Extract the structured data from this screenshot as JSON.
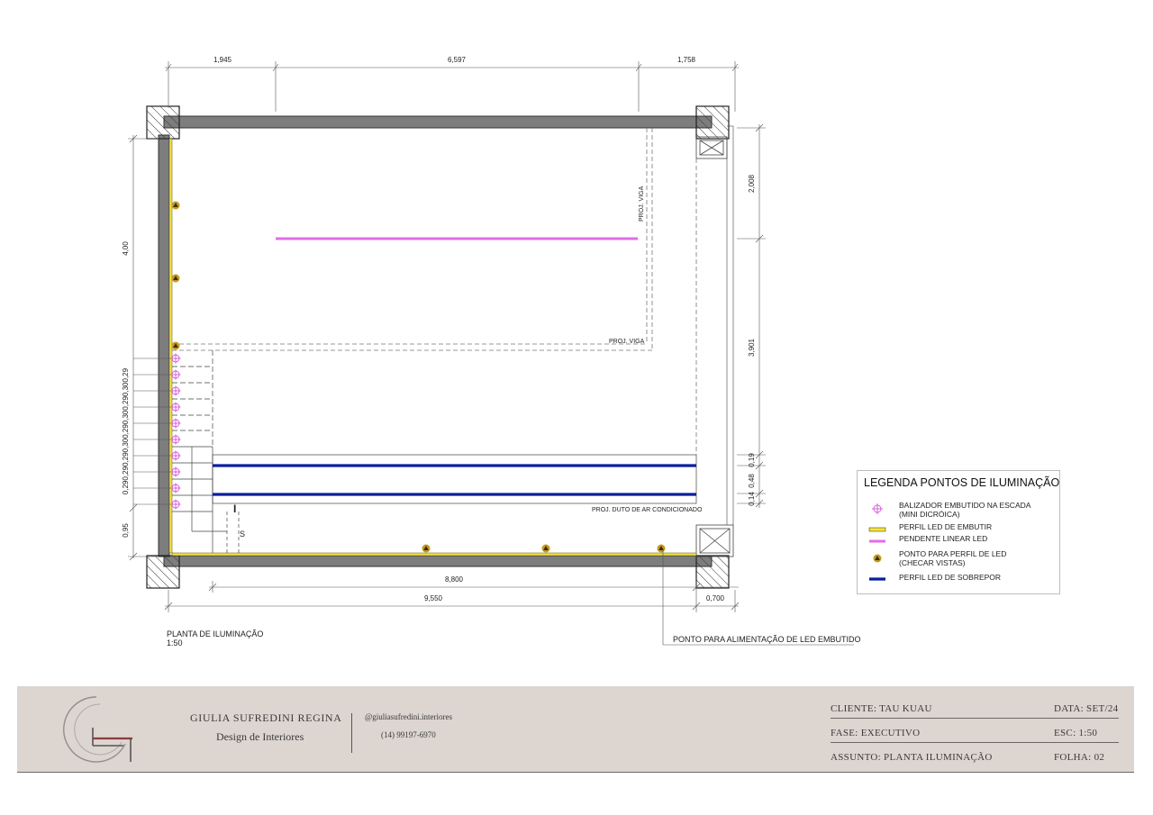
{
  "drawing": {
    "dims_top": [
      "1,945",
      "6,597",
      "1,758"
    ],
    "dims_right": [
      "2,008",
      "3,901",
      "0,19",
      "0,48",
      "0,14"
    ],
    "dim_left_main": "4,00",
    "dim_left_stairs": "0,290,290,290,300,290,300,290,300,29",
    "dim_left_bottom": "0,95",
    "dim_inner_bottom": "8,800",
    "dim_outer_bottom": "9,550",
    "dim_corner_bottom": "0,700",
    "labels": {
      "beam_vertical": "PROJ. VIGA",
      "beam_horizontal": "PROJ. VIGA",
      "duct": "PROJ. DUTO DE AR CONDICIONADO",
      "stair_i": "I",
      "stair_s": "S",
      "feed_note": "PONTO PARA ALIMENTAÇÃO DE LED EMBUTIDO",
      "plan_title": "PLANTA DE ILUMINAÇÃO",
      "plan_scale": "1:50"
    },
    "colors": {
      "wall": "#7d7d7d",
      "led_embed": "#f2e443",
      "pendant": "#e36ce6",
      "overlay": "#0a1e9e",
      "spot": "#c49a1e",
      "balizador": "#d455d8"
    }
  },
  "legend": {
    "title": "LEGENDA PONTOS DE ILUMINAÇÃO",
    "items": [
      {
        "symbol": "crosshair-circle",
        "line1": "BALIZADOR EMBUTIDO NA ESCADA",
        "line2": "(MINI DICRÓICA)"
      },
      {
        "symbol": "yellow-bar",
        "line1": "PERFIL LED DE EMBUTIR",
        "line2": ""
      },
      {
        "symbol": "magenta-line",
        "line1": "PENDENTE LINEAR LED",
        "line2": ""
      },
      {
        "symbol": "triangle-dot",
        "line1": "PONTO PARA PERFIL DE LED",
        "line2": "(CHECAR VISTAS)"
      },
      {
        "symbol": "blue-line",
        "line1": "PERFIL LED DE SOBREPOR",
        "line2": ""
      }
    ]
  },
  "titleblock": {
    "designer": "GIULIA SUFREDINI REGINA",
    "subtitle": "Design de Interiores",
    "instagram": "@giuliasufredini.interiores",
    "phone": "(14) 99197-6970",
    "cliente": "CLIENTE: TAU KUAU",
    "data": "DATA: SET/24",
    "fase": "FASE: EXECUTIVO",
    "esc": "ESC:  1:50",
    "assunto": "ASSUNTO: PLANTA ILUMINAÇÃO",
    "folha": "FOLHA:  02"
  }
}
